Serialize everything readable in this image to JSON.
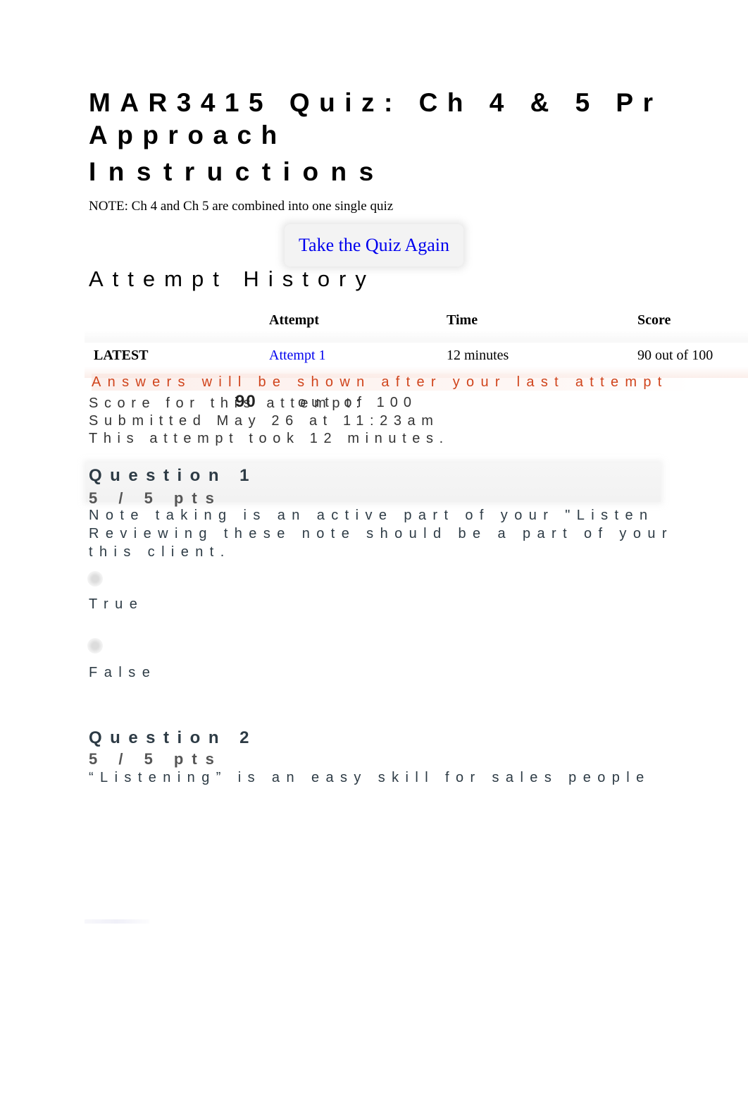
{
  "page": {
    "title_line1": "MAR3415 Quiz: Ch 4 & 5 Pr",
    "title_line2": "Approach",
    "instructions_heading": "Instructions",
    "note": "NOTE: Ch 4 and Ch 5 are combined into one single quiz",
    "take_quiz_again": "Take the Quiz Again"
  },
  "attempt_history": {
    "heading": "Attempt History",
    "columns": [
      "",
      "Attempt",
      "Time",
      "Score"
    ],
    "rows": [
      {
        "label": "LATEST",
        "attempt": "Attempt 1",
        "time": "12 minutes",
        "score": "90 out of 100"
      }
    ]
  },
  "attempt_summary": {
    "answers_notice": "Answers will be shown after your last attempt",
    "score_label": "Score for this attempt:",
    "score_value": "90",
    "score_out_of": "out of 100",
    "submitted": "Submitted May 26 at 11:23am",
    "duration": "This attempt took 12 minutes."
  },
  "questions": [
    {
      "title": "Question 1",
      "points": "5 / 5 pts",
      "text_lines": [
        "Note taking is an active part of your \"Listen",
        "Reviewing these note should be a part of your",
        "this client."
      ],
      "answers": [
        "True",
        "False"
      ]
    },
    {
      "title": "Question 2",
      "points": "5 / 5 pts",
      "text_lines": [
        "“Listening” is an easy skill for sales people"
      ],
      "answers": []
    }
  ]
}
